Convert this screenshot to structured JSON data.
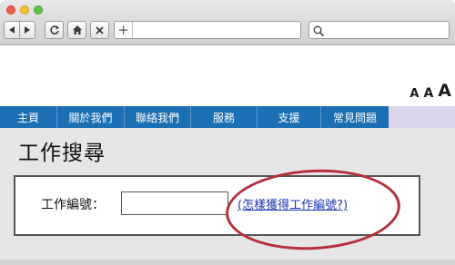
{
  "browser": {
    "url_placeholder": "",
    "search_placeholder": "",
    "plus_label": "+"
  },
  "font_size_controls": [
    "A",
    "A",
    "A"
  ],
  "nav": {
    "items": [
      "主頁",
      "關於我們",
      "聯絡我們",
      "服務",
      "支援",
      "常見問題"
    ]
  },
  "page": {
    "title": "工作搜尋",
    "job_label": "工作編號：",
    "job_input_value": "",
    "help_link": "(怎樣獲得工作編號?)"
  },
  "colors": {
    "nav_bg": "#1c6fb2",
    "highlight": "#b3303a",
    "link": "#1a35b0"
  }
}
